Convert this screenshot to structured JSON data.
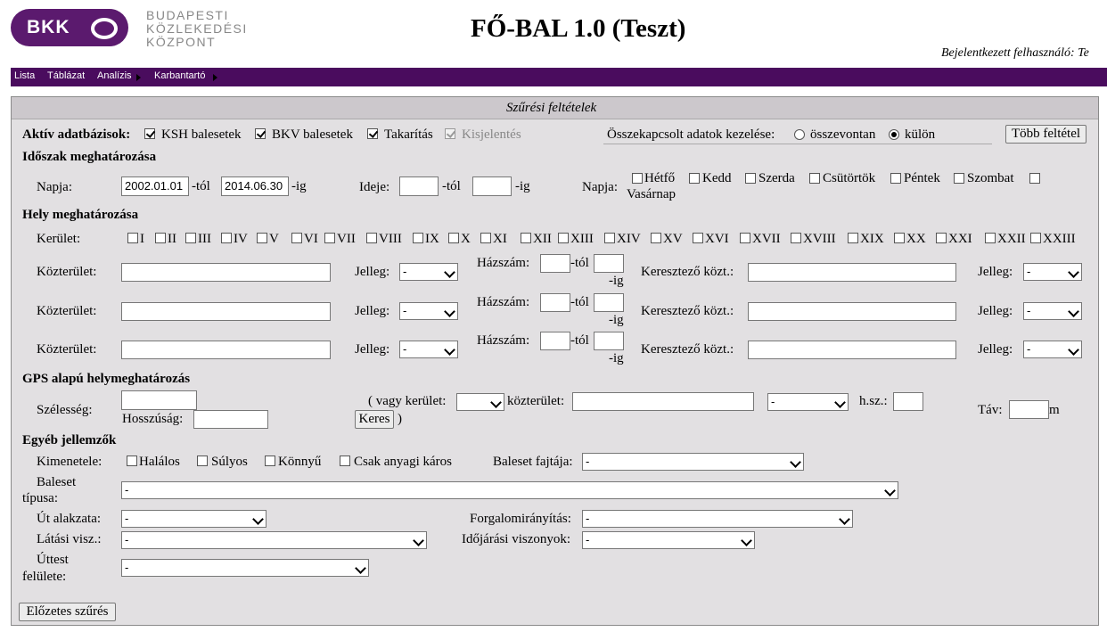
{
  "logo": {
    "badge_text": "BKK",
    "line1": "BUDAPESTI",
    "line2": "KÖZLEKEDÉSI",
    "line3": "KÖZPONT"
  },
  "header": {
    "title": "FŐ-BAL 1.0 (Teszt)",
    "user_label": "Bejelentkezett felhasználó: Te"
  },
  "menu": {
    "items": [
      "Lista",
      "Táblázat",
      "Analízis",
      "Karbantartó"
    ]
  },
  "panel": {
    "title": "Szűrési feltételek"
  },
  "databases": {
    "label": "Aktív adatbázisok:",
    "items": [
      {
        "label": "KSH balesetek",
        "checked": true
      },
      {
        "label": "BKV balesetek",
        "checked": true
      },
      {
        "label": "Takarítás",
        "checked": true
      },
      {
        "label": "Kisjelentés",
        "checked": true,
        "disabled": true
      }
    ],
    "merge_label": "Összekapcsolt adatok kezelése:",
    "merge_options": [
      "összevontan",
      "külön"
    ],
    "merge_selected": "külön",
    "more_button": "Több feltétel"
  },
  "period": {
    "title": "Időszak meghatározása",
    "day_label": "Napja:",
    "from_value": "2002.01.01",
    "from_suffix": "-tól",
    "to_value": "2014.06.30",
    "to_suffix": "-ig",
    "time_label": "Ideje:",
    "time_from_suffix": "-tól",
    "time_to_suffix": "-ig",
    "weekday_label": "Napja:",
    "weekdays": [
      "Hétfő",
      "Kedd",
      "Szerda",
      "Csütörtök",
      "Péntek",
      "Szombat",
      "Vasárnap"
    ]
  },
  "place": {
    "title": "Hely meghatározása",
    "district_label": "Kerület:",
    "districts": [
      "I",
      "II",
      "III",
      "IV",
      "V",
      "VI",
      "VII",
      "VIII",
      "IX",
      "X",
      "XI",
      "XII",
      "XIII",
      "XIV",
      "XV",
      "XVI",
      "XVII",
      "XVIII",
      "XIX",
      "XX",
      "XXI",
      "XXII",
      "XXIII"
    ],
    "street_label": "Közterület:",
    "type_label": "Jelleg:",
    "type_value": "-",
    "housenum_label": "Házszám:",
    "from_suffix": "-tól",
    "to_suffix": "-ig",
    "cross_label": "Keresztező közt.:",
    "cross_type_label": "Jelleg:",
    "cross_type_value": "-"
  },
  "gps": {
    "title": "GPS alapú helymeghatározás",
    "lat_label": "Szélesség:",
    "lon_label": "Hosszúság:",
    "or_district_label": "( vagy kerület:",
    "street_label": "közterület:",
    "street_type_value": "-",
    "housenum_label": "h.sz.:",
    "search_button": "Keres",
    "close_paren": ")",
    "dist_label": "Táv:",
    "dist_unit": "m"
  },
  "other": {
    "title": "Egyéb jellemzők",
    "outcome_label": "Kimenetele:",
    "outcomes": [
      "Halálos",
      "Súlyos",
      "Könnyű",
      "Csak anyagi káros"
    ],
    "acc_kind_label": "Baleset fajtája:",
    "acc_kind_value": "-",
    "acc_type_label1": "Baleset",
    "acc_type_label2": "típusa:",
    "acc_type_value": "-",
    "road_shape_label": "Út alakzata:",
    "road_shape_value": "-",
    "traffic_ctrl_label": "Forgalomirányítás:",
    "traffic_ctrl_value": "-",
    "visibility_label": "Látási visz.:",
    "visibility_value": "-",
    "weather_label": "Időjárási viszonyok:",
    "weather_value": "-",
    "surface_label1": "Úttest",
    "surface_label2": "felülete:",
    "surface_value": "-"
  },
  "prefilter_button": "Előzetes szűrés"
}
